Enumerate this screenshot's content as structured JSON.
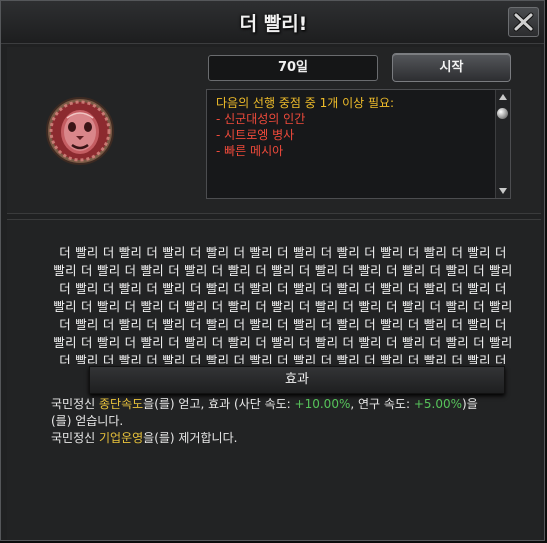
{
  "window": {
    "title": "더 빨리!"
  },
  "header": {
    "date_label": "70일",
    "start_label": "시작"
  },
  "requirements": {
    "heading": "다음의 선행 중점 중 1개 이상 필요:",
    "items": [
      "- 신군대성의 인간",
      "- 시트로엥 병사",
      "- 빠른 메시아"
    ]
  },
  "description": {
    "text": "더 빨리 더 빨리 더 빨리 더 빨리 더 빨리 더 빨리 더 빨리 더 빨리 더 빨리 더 빨리 더 빨리 더 빨리 더 빨리 더 빨리 더 빨리 더 빨리 더 빨리 더 빨리 더 빨리 더 빨리 더 빨리 더 빨리 더 빨리 더 빨리 더 빨리 더 빨리 더 빨리 더 빨리 더 빨리 더 빨리 더 빨리 더 빨리 더 빨리 더 빨리 더 빨리 더 빨리 더 빨리 더 빨리 더 빨리 더 빨리 더 빨리 더 빨리 더 빨리 더 빨리 더 빨리 더 빨리 더 빨리 더 빨리 더 빨리 더 빨리 더 빨리 더 빨리 더 빨리 더 빨리 더 빨리 더 빨리 더 빨리 더 빨리 더 빨리 더 빨리 더 빨리 더 빨리 더 빨리 더 빨리 더 빨리 더 빨리 더 빨리 더 빨리 더 빨리 더 빨리 더 빨리 더 빨리 더 빨리 더 빨리"
  },
  "effect": {
    "title": "효과",
    "line1_prefix": "국민정신 ",
    "line1_highlight": "종단속도",
    "line1_mid": "을(를) 얻고, 효과 (사단 속도: ",
    "line1_value1": "+10.00%",
    "line1_mid2": ", 연구 속도: ",
    "line1_value2": "+5.00%",
    "line1_suffix": ")을(를) 얻습니다.",
    "line2_prefix": "국민정신 ",
    "line2_highlight": "기업운영",
    "line2_suffix": "을(를) 제거합니다."
  },
  "icons": {
    "close": "close-icon",
    "emblem": "focus-emblem-icon"
  },
  "colors": {
    "requirement_title": "#f0bd2a",
    "requirement_item": "#ef4a3b",
    "highlight": "#e8c23b",
    "positive": "#56c25a"
  }
}
